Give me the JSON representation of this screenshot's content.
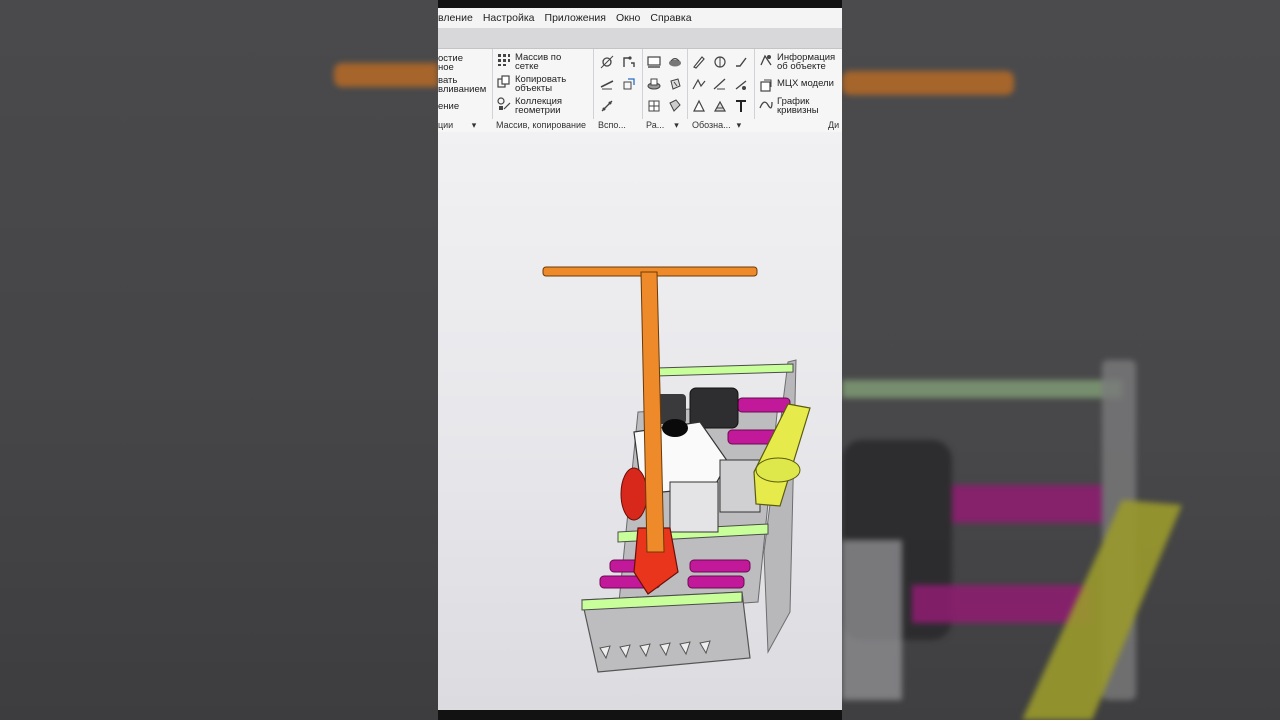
{
  "menu": {
    "items": [
      "вление",
      "Настройка",
      "Приложения",
      "Окно",
      "Справка"
    ]
  },
  "ribbon": {
    "group1": {
      "lines": [
        "остие",
        "ное",
        "вать",
        "вливанием",
        "ение"
      ],
      "label": "ции"
    },
    "group2": {
      "items": [
        {
          "line1": "Массив по",
          "line2": "сетке",
          "icon": "grid-array-icon"
        },
        {
          "line1": "Копировать",
          "line2": "объекты",
          "icon": "copy-objects-icon"
        },
        {
          "line1": "Коллекция",
          "line2": "геометрии",
          "icon": "geometry-collection-icon"
        }
      ],
      "label": "Массив, копирование"
    },
    "group3": {
      "label": "Вспо..."
    },
    "group4": {
      "label": "Ра..."
    },
    "group5": {
      "label": "Обозна..."
    },
    "group6": {
      "items": [
        {
          "line1": "Информация",
          "line2": "об объекте",
          "icon": "object-info-icon"
        },
        {
          "line1": "МЦХ модели",
          "line2": "",
          "icon": "mass-properties-icon"
        },
        {
          "line1": "График",
          "line2": "кривизны",
          "icon": "curvature-graph-icon"
        }
      ],
      "label": "Ди"
    }
  },
  "icons": {
    "group3": [
      "sketch-point-icon",
      "constraint-icon",
      "line-segment-icon",
      "offset-curve-icon",
      "node-icon",
      "polyline-icon"
    ],
    "group4": [
      "view-plane-icon",
      "surface-icon",
      "block-icon",
      "rotate-view-icon",
      "section-icon",
      "cut-icon"
    ],
    "group5": [
      "pen-icon",
      "dimension-icon",
      "roughness-icon",
      "leader-icon",
      "base-icon",
      "text-tool-icon"
    ]
  },
  "model": {
    "colors": {
      "handle": "#ee8a2a",
      "red_parts": "#e8351c",
      "magenta_rollers": "#c2189a",
      "yellow_guard": "#e6ea4a",
      "lime_rails": "#c8ff9a",
      "frame_gray": "#b4b4b6"
    }
  }
}
